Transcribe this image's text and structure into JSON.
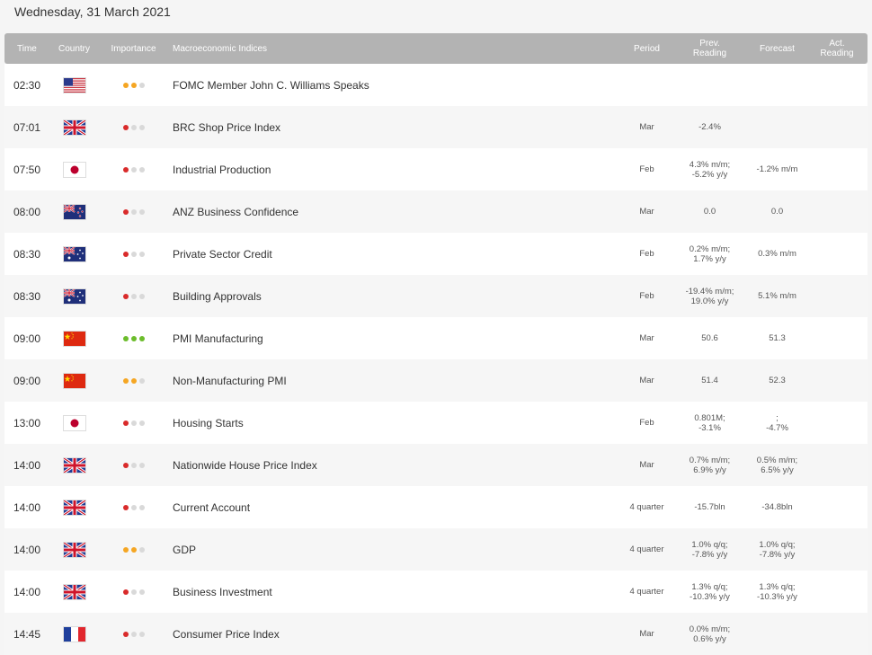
{
  "page": {
    "date": "Wednesday, 31 March 2021"
  },
  "header": {
    "time": "Time",
    "country": "Country",
    "importance": "Importance",
    "indices": "Macroeconomic Indices",
    "period": "Period",
    "prev": "Prev.\nReading",
    "forecast": "Forecast",
    "actual": "Act.\nReading"
  },
  "colors": {
    "high": "#6cbd2c",
    "medium": "#f5a623",
    "low": "#d92b2b",
    "inactive": "#d9d9d9"
  },
  "events": [
    {
      "time": "02:30",
      "country": "us",
      "importance": "medium",
      "name": "FOMC Member John C. Williams Speaks",
      "period": "",
      "prev": [],
      "forecast": [],
      "actual": []
    },
    {
      "time": "07:01",
      "country": "gb",
      "importance": "low",
      "name": "BRC Shop Price Index",
      "period": "Mar",
      "prev": [
        "-2.4%"
      ],
      "forecast": [],
      "actual": []
    },
    {
      "time": "07:50",
      "country": "jp",
      "importance": "low",
      "name": "Industrial Production",
      "period": "Feb",
      "prev": [
        "4.3% m/m;",
        "-5.2% y/y"
      ],
      "forecast": [
        "-1.2% m/m"
      ],
      "actual": []
    },
    {
      "time": "08:00",
      "country": "nz",
      "importance": "low",
      "name": "ANZ Business Confidence",
      "period": "Mar",
      "prev": [
        "0.0"
      ],
      "forecast": [
        "0.0"
      ],
      "actual": []
    },
    {
      "time": "08:30",
      "country": "au",
      "importance": "low",
      "name": "Private Sector Credit",
      "period": "Feb",
      "prev": [
        "0.2% m/m;",
        "1.7% y/y"
      ],
      "forecast": [
        "0.3% m/m"
      ],
      "actual": []
    },
    {
      "time": "08:30",
      "country": "au",
      "importance": "low",
      "name": "Building Approvals",
      "period": "Feb",
      "prev": [
        "-19.4% m/m;",
        "19.0% y/y"
      ],
      "forecast": [
        "5.1% m/m"
      ],
      "actual": []
    },
    {
      "time": "09:00",
      "country": "cn",
      "importance": "high",
      "name": "PMI Manufacturing",
      "period": "Mar",
      "prev": [
        "50.6"
      ],
      "forecast": [
        "51.3"
      ],
      "actual": []
    },
    {
      "time": "09:00",
      "country": "cn",
      "importance": "medium",
      "name": "Non-Manufacturing PMI",
      "period": "Mar",
      "prev": [
        "51.4"
      ],
      "forecast": [
        "52.3"
      ],
      "actual": []
    },
    {
      "time": "13:00",
      "country": "jp",
      "importance": "low",
      "name": "Housing Starts",
      "period": "Feb",
      "prev": [
        "0.801M;",
        "-3.1%"
      ],
      "forecast": [
        ";",
        "-4.7%"
      ],
      "actual": []
    },
    {
      "time": "14:00",
      "country": "gb",
      "importance": "low",
      "name": "Nationwide House Price Index",
      "period": "Mar",
      "prev": [
        "0.7% m/m;",
        "6.9% y/y"
      ],
      "forecast": [
        "0.5% m/m;",
        "6.5% y/y"
      ],
      "actual": []
    },
    {
      "time": "14:00",
      "country": "gb",
      "importance": "low",
      "name": "Current Account",
      "period": "4 quarter",
      "prev": [
        "-15.7bln"
      ],
      "forecast": [
        "-34.8bln"
      ],
      "actual": []
    },
    {
      "time": "14:00",
      "country": "gb",
      "importance": "medium",
      "name": "GDP",
      "period": "4 quarter",
      "prev": [
        "1.0% q/q;",
        "-7.8% y/y"
      ],
      "forecast": [
        "1.0% q/q;",
        "-7.8% y/y"
      ],
      "actual": []
    },
    {
      "time": "14:00",
      "country": "gb",
      "importance": "low",
      "name": "Business Investment",
      "period": "4 quarter",
      "prev": [
        "1.3% q/q;",
        "-10.3% y/y"
      ],
      "forecast": [
        "1.3% q/q;",
        "-10.3% y/y"
      ],
      "actual": []
    },
    {
      "time": "14:45",
      "country": "fr",
      "importance": "low",
      "name": "Consumer Price Index",
      "period": "Mar",
      "prev": [
        "0.0% m/m;",
        "0.6% y/y"
      ],
      "forecast": [],
      "actual": []
    }
  ]
}
